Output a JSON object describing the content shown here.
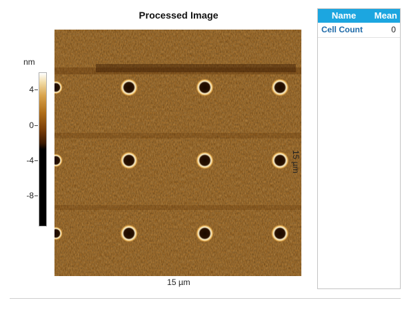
{
  "image": {
    "title": "Processed Image"
  },
  "colorbar": {
    "unit": "nm",
    "ticks": [
      "4",
      "0",
      "-4",
      "-8"
    ]
  },
  "axes": {
    "x_label": "15 µm",
    "y_label": "15 µm"
  },
  "table": {
    "headers": {
      "name": "Name",
      "mean": "Mean"
    },
    "rows": [
      {
        "name": "Cell Count",
        "mean": "0"
      }
    ]
  },
  "colors": {
    "header_bg": "#1ca6e0",
    "accent_text": "#1e6aa8",
    "afm_base": "#9a5d12"
  }
}
